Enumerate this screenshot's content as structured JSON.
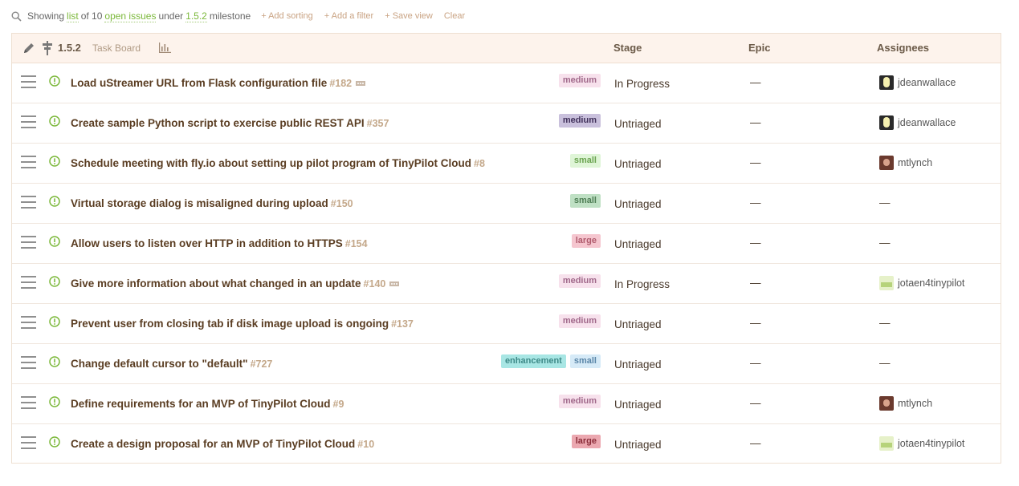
{
  "filter": {
    "showing": "Showing",
    "list_link": "list",
    "of_text": "of 10",
    "open_issues_link": "open issues",
    "under_text": "under",
    "milestone_link": "1.5.2",
    "milestone_word": "milestone",
    "add_sorting": "+ Add sorting",
    "add_filter": "+ Add a filter",
    "save_view": "+ Save view",
    "clear": "Clear"
  },
  "header": {
    "milestone": "1.5.2",
    "task_board": "Task Board",
    "stage": "Stage",
    "epic": "Epic",
    "assignees": "Assignees"
  },
  "colors": {
    "accent_green": "#7bb83a",
    "link_tan": "#c9a383",
    "header_bg": "#fdf3ec"
  },
  "issues": [
    {
      "title": "Load uStreamer URL from Flask configuration file",
      "number": "#182",
      "more": true,
      "labels": [
        {
          "text": "medium",
          "bg": "#f7e1ec",
          "fg": "#a0688a"
        }
      ],
      "stage": "In Progress",
      "epic": "—",
      "assignee": "jdeanwallace",
      "avatar": "jdean"
    },
    {
      "title": "Create sample Python script to exercise public REST API",
      "number": "#357",
      "more": false,
      "labels": [
        {
          "text": "medium",
          "bg": "#c9c0dc",
          "fg": "#40305a"
        }
      ],
      "stage": "Untriaged",
      "epic": "—",
      "assignee": "jdeanwallace",
      "avatar": "jdean"
    },
    {
      "title": "Schedule meeting with fly.io about setting up pilot program of TinyPilot Cloud",
      "number": "#8",
      "more": false,
      "labels": [
        {
          "text": "small",
          "bg": "#dff5d7",
          "fg": "#6aa34f"
        }
      ],
      "stage": "Untriaged",
      "epic": "—",
      "assignee": "mtlynch",
      "avatar": "mt"
    },
    {
      "title": "Virtual storage dialog is misaligned during upload",
      "number": "#150",
      "more": false,
      "labels": [
        {
          "text": "small",
          "bg": "#bfe0c4",
          "fg": "#4f7e55"
        }
      ],
      "stage": "Untriaged",
      "epic": "—",
      "assignee": "—",
      "avatar": ""
    },
    {
      "title": "Allow users to listen over HTTP in addition to HTTPS",
      "number": "#154",
      "more": false,
      "labels": [
        {
          "text": "large",
          "bg": "#f5c6cf",
          "fg": "#b05a6c"
        }
      ],
      "stage": "Untriaged",
      "epic": "—",
      "assignee": "—",
      "avatar": ""
    },
    {
      "title": "Give more information about what changed in an update",
      "number": "#140",
      "more": true,
      "labels": [
        {
          "text": "medium",
          "bg": "#f7e1ec",
          "fg": "#a0688a"
        }
      ],
      "stage": "In Progress",
      "epic": "—",
      "assignee": "jotaen4tinypilot",
      "avatar": "jot"
    },
    {
      "title": "Prevent user from closing tab if disk image upload is ongoing",
      "number": "#137",
      "more": false,
      "labels": [
        {
          "text": "medium",
          "bg": "#f7e1ec",
          "fg": "#a0688a"
        }
      ],
      "stage": "Untriaged",
      "epic": "—",
      "assignee": "—",
      "avatar": ""
    },
    {
      "title": "Change default cursor to \"default\"",
      "number": "#727",
      "more": false,
      "labels": [
        {
          "text": "enhancement",
          "bg": "#a8e6e4",
          "fg": "#3e8a88"
        },
        {
          "text": "small",
          "bg": "#d6eaf7",
          "fg": "#5a86a8"
        }
      ],
      "stage": "Untriaged",
      "epic": "—",
      "assignee": "—",
      "avatar": ""
    },
    {
      "title": "Define requirements for an MVP of TinyPilot Cloud",
      "number": "#9",
      "more": false,
      "labels": [
        {
          "text": "medium",
          "bg": "#f7e1ec",
          "fg": "#a0688a"
        }
      ],
      "stage": "Untriaged",
      "epic": "—",
      "assignee": "mtlynch",
      "avatar": "mt"
    },
    {
      "title": "Create a design proposal for an MVP of TinyPilot Cloud",
      "number": "#10",
      "more": false,
      "labels": [
        {
          "text": "large",
          "bg": "#eba8b0",
          "fg": "#8a2b38"
        }
      ],
      "stage": "Untriaged",
      "epic": "—",
      "assignee": "jotaen4tinypilot",
      "avatar": "jot"
    }
  ]
}
